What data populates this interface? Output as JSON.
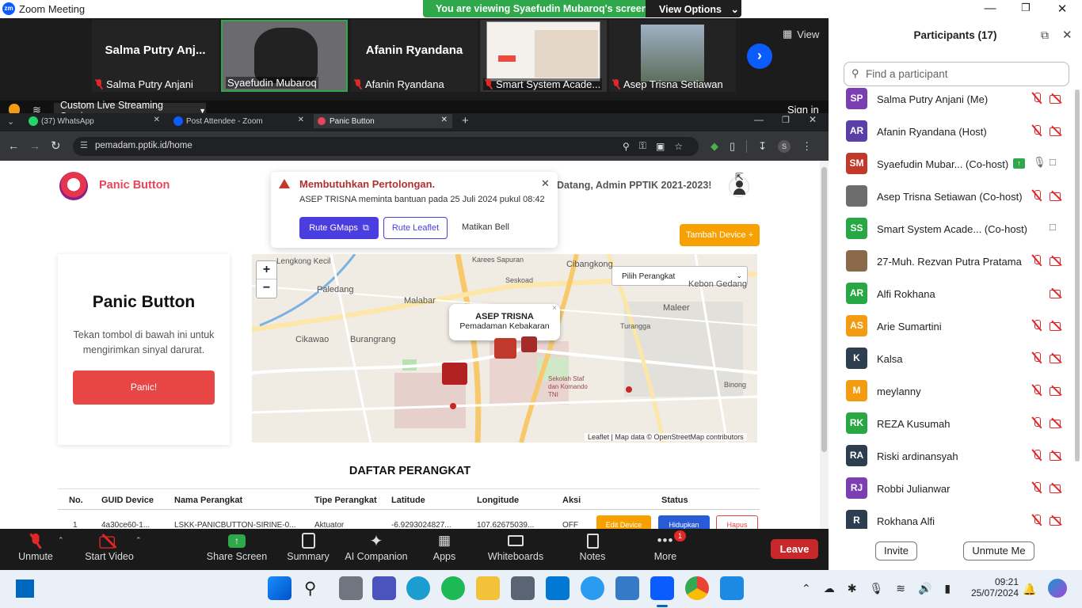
{
  "titlebar": {
    "app_title": "Zoom Meeting",
    "banner": "You are viewing Syaefudin Mubaroq's screen",
    "view_options": "View Options"
  },
  "video_strip": {
    "view_label": "View",
    "tiles": [
      {
        "title": "Salma Putry Anj...",
        "label": "Salma Putry Anjani"
      },
      {
        "title": "",
        "label": "Syaefudin Mubaroq"
      },
      {
        "title": "Afanin Ryandana",
        "label": "Afanin Ryandana"
      },
      {
        "title": "",
        "label": "Smart System Acade..."
      },
      {
        "title": "",
        "label": "Asep Trisna Setiawan"
      }
    ]
  },
  "share_bar": {
    "streaming": "Custom Live Streaming Service",
    "signin": "Sign in"
  },
  "participants": {
    "header": "Participants (17)",
    "search_placeholder": "Find a participant",
    "list": [
      {
        "initials": "SP",
        "name": "Salma Putry Anjani (Me)",
        "color": "#7b3fb3"
      },
      {
        "initials": "AR",
        "name": "Afanin Ryandana (Host)",
        "color": "#5b3fa8"
      },
      {
        "initials": "SM",
        "name": "Syaefudin Mubar... (Co-host)",
        "color": "#c0392b"
      },
      {
        "initials": "",
        "name": "Asep Trisna Setiawan (Co-host)",
        "color": "#6d6d6d"
      },
      {
        "initials": "SS",
        "name": "Smart System Acade...  (Co-host)",
        "color": "#27a845"
      },
      {
        "initials": "",
        "name": "27-Muh. Rezvan Putra Pratama",
        "color": "#8a6a4a"
      },
      {
        "initials": "AR",
        "name": "Alfi Rokhana",
        "color": "#27a845"
      },
      {
        "initials": "AS",
        "name": "Arie Sumartini",
        "color": "#f39c12"
      },
      {
        "initials": "K",
        "name": "Kalsa",
        "color": "#2c3e50"
      },
      {
        "initials": "M",
        "name": "meylanny",
        "color": "#f39c12"
      },
      {
        "initials": "RK",
        "name": "REZA Kusumah",
        "color": "#27a845"
      },
      {
        "initials": "RA",
        "name": "Riski ardinansyah",
        "color": "#2c3e50"
      },
      {
        "initials": "RJ",
        "name": "Robbi Julianwar",
        "color": "#7b3fb3"
      },
      {
        "initials": "R",
        "name": "Rokhana Alfi",
        "color": "#2c3e50"
      }
    ],
    "invite": "Invite",
    "unmute_me": "Unmute Me"
  },
  "browser": {
    "tabs": [
      {
        "label": "(37) WhatsApp"
      },
      {
        "label": "Post Attendee - Zoom"
      },
      {
        "label": "Panic Button"
      }
    ],
    "url": "pemadam.pptik.id/home"
  },
  "page": {
    "brand": "Panic Button",
    "welcome": "Datang, Admin PPTIK 2021-2023!",
    "alert": {
      "title": "Membutuhkan Pertolongan.",
      "message": "ASEP TRISNA meminta bantuan pada 25 Juli 2024 pukul 08:42",
      "btn_gmaps": "Rute GMaps",
      "btn_leaflet": "Rute Leaflet",
      "btn_bell": "Matikan Bell"
    },
    "add_device": "Tambah Device +",
    "panic_card": {
      "title": "Panic Button",
      "desc": "Tekan tombol di bawah ini untuk mengirimkan sinyal darurat.",
      "button": "Panic!"
    },
    "map": {
      "select": "Pilih Perangkat",
      "popup_title": "ASEP TRISNA",
      "popup_sub": "Pemadaman Kebakaran",
      "attribution": "Leaflet | Map data © OpenStreetMap contributors",
      "labels": [
        "Lengkong Kecil",
        "Paledang",
        "Malabar",
        "Karees Sapuran",
        "Seskoad",
        "Cibangkong",
        "Cikawao",
        "Burangrang",
        "Turangga",
        "Maleer",
        "Kebon Gedang",
        "Binong",
        "Sekolah Staf dan Komando TNI"
      ]
    },
    "table": {
      "heading": "DAFTAR PERANGKAT",
      "headers": [
        "No.",
        "GUID Device",
        "Nama Perangkat",
        "Tipe Perangkat",
        "Latitude",
        "Longitude",
        "Aksi",
        "Status"
      ],
      "row": [
        "1",
        "4a30ce60-1...",
        "LSKK-PANICBUTTON-SIRINE-0...",
        "Aktuator",
        "-6.9293024827...",
        "107.62675039...",
        "OFF"
      ],
      "row_buttons": [
        "Edit Device",
        "Hidupkan",
        "Hapus"
      ]
    }
  },
  "toolbar": {
    "items": [
      "Unmute",
      "Start Video",
      "Share Screen",
      "Summary",
      "AI Companion",
      "Apps",
      "Whiteboards",
      "Notes",
      "More"
    ],
    "more_badge": "1",
    "leave": "Leave"
  },
  "taskbar": {
    "time": "09:21",
    "date": "25/07/2024"
  }
}
